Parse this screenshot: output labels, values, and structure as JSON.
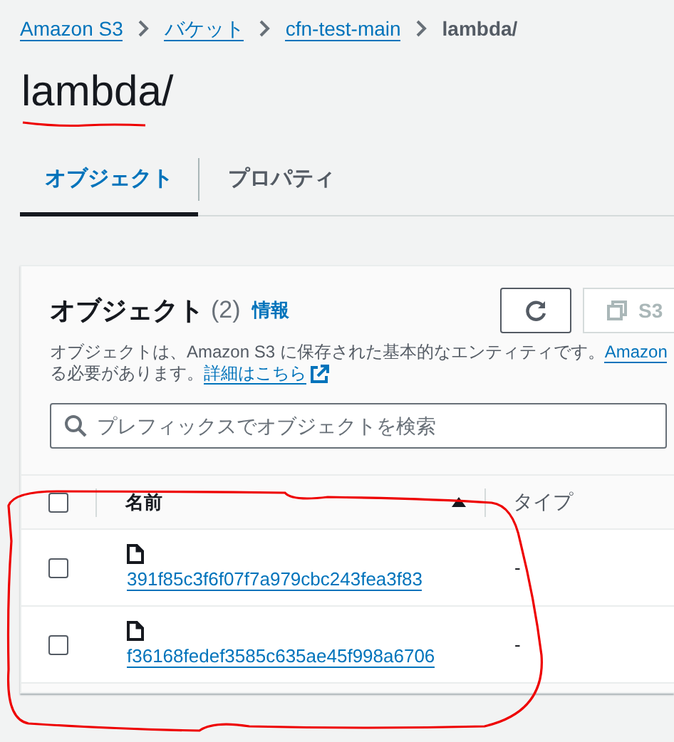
{
  "breadcrumbs": [
    {
      "label": "Amazon S3",
      "current": false
    },
    {
      "label": "バケット",
      "current": false
    },
    {
      "label": "cfn-test-main",
      "current": false
    },
    {
      "label": "lambda/",
      "current": true
    }
  ],
  "title": "lambda/",
  "tabs": [
    {
      "label": "オブジェクト",
      "selected": true
    },
    {
      "label": "プロパティ",
      "selected": false
    }
  ],
  "panel": {
    "heading": "オブジェクト",
    "count": "(2)",
    "info": "情報",
    "copy_button": {
      "label": "S3",
      "disabled": true
    },
    "description": {
      "line_1": "オブジェクトは、Amazon S3 に保存された基本的なエンティティです。",
      "line_1_link": "Amazon",
      "line_2": "る必要があります。",
      "details_link": "詳細はこちら"
    },
    "search": {
      "placeholder": "プレフィックスでオブジェクトを検索"
    },
    "table": {
      "all_checked": false,
      "columns": [
        {
          "label": "名前",
          "sorted": true
        },
        {
          "label": "タイプ",
          "sorted": false
        }
      ],
      "rows": [
        {
          "name": "391f85c3f6f07f7a979cbc243fea3f83",
          "type": "-",
          "selected": false
        },
        {
          "name": "f36168fedef3585c635ae45f998a6706",
          "type": "-",
          "selected": false
        }
      ]
    }
  }
}
